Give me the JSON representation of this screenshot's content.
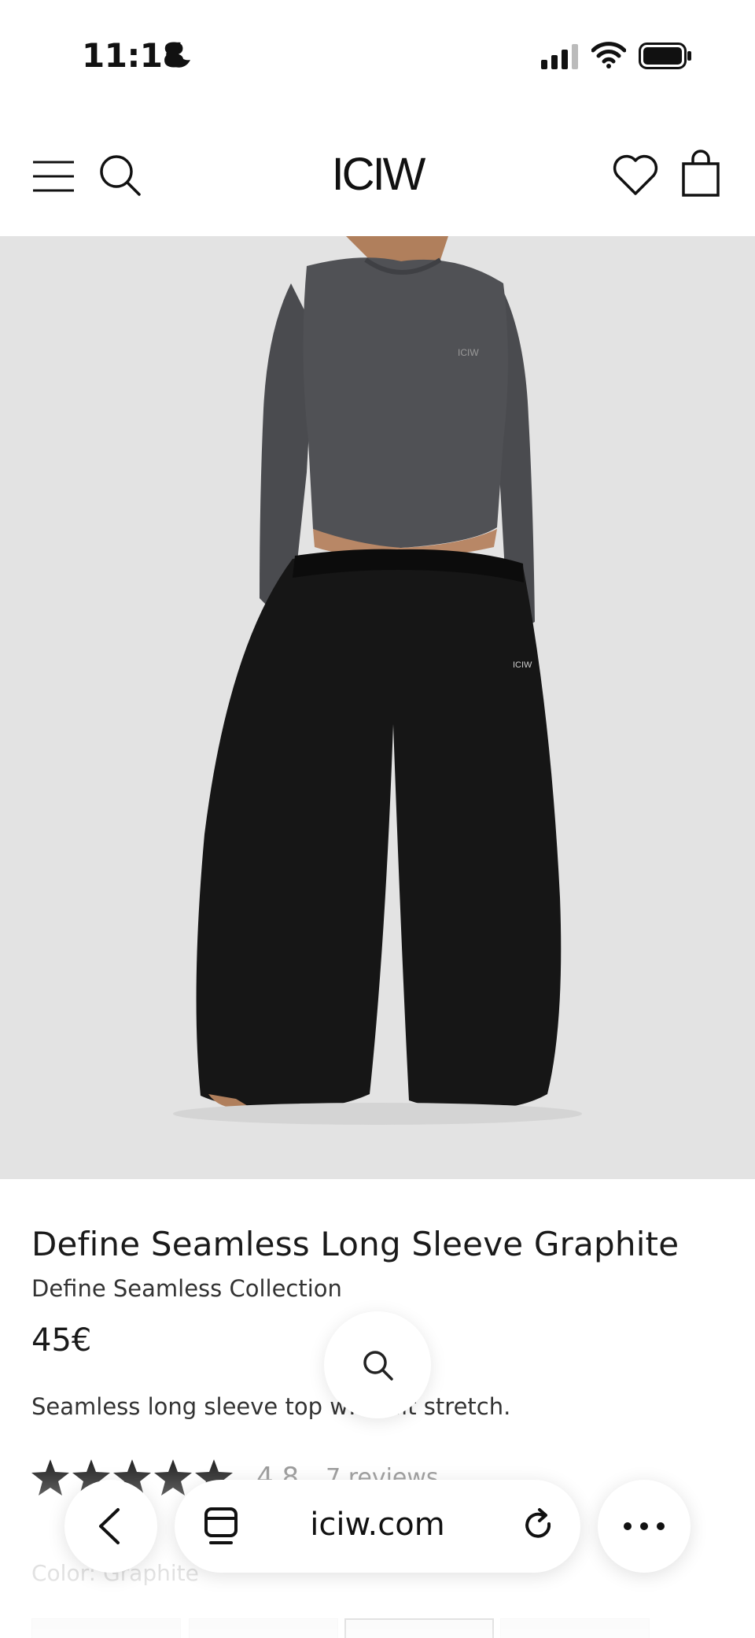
{
  "status_bar": {
    "time": "11:18",
    "icons": [
      "moon-icon",
      "signal-icon",
      "wifi-icon",
      "battery-icon"
    ]
  },
  "header": {
    "logo": "ICIW",
    "icons": [
      "menu-icon",
      "search-icon",
      "heart-icon",
      "bag-icon"
    ]
  },
  "product": {
    "title": "Define Seamless Long Sleeve Graphite",
    "collection": "Define Seamless Collection",
    "price": "45€",
    "description": "Seamless long sleeve top w… …it stretch.",
    "rating": {
      "value": "4.8",
      "stars": 5,
      "reviews": "7 reviews"
    },
    "color_label": "Color: Graphite"
  },
  "browser": {
    "url": "iciw.com",
    "icons": [
      "back-icon",
      "tabs-icon",
      "reload-icon",
      "more-icon"
    ]
  },
  "colors": {
    "image_background": "#e3e3e3",
    "text": "#1a1a1a",
    "muted": "#999999"
  }
}
